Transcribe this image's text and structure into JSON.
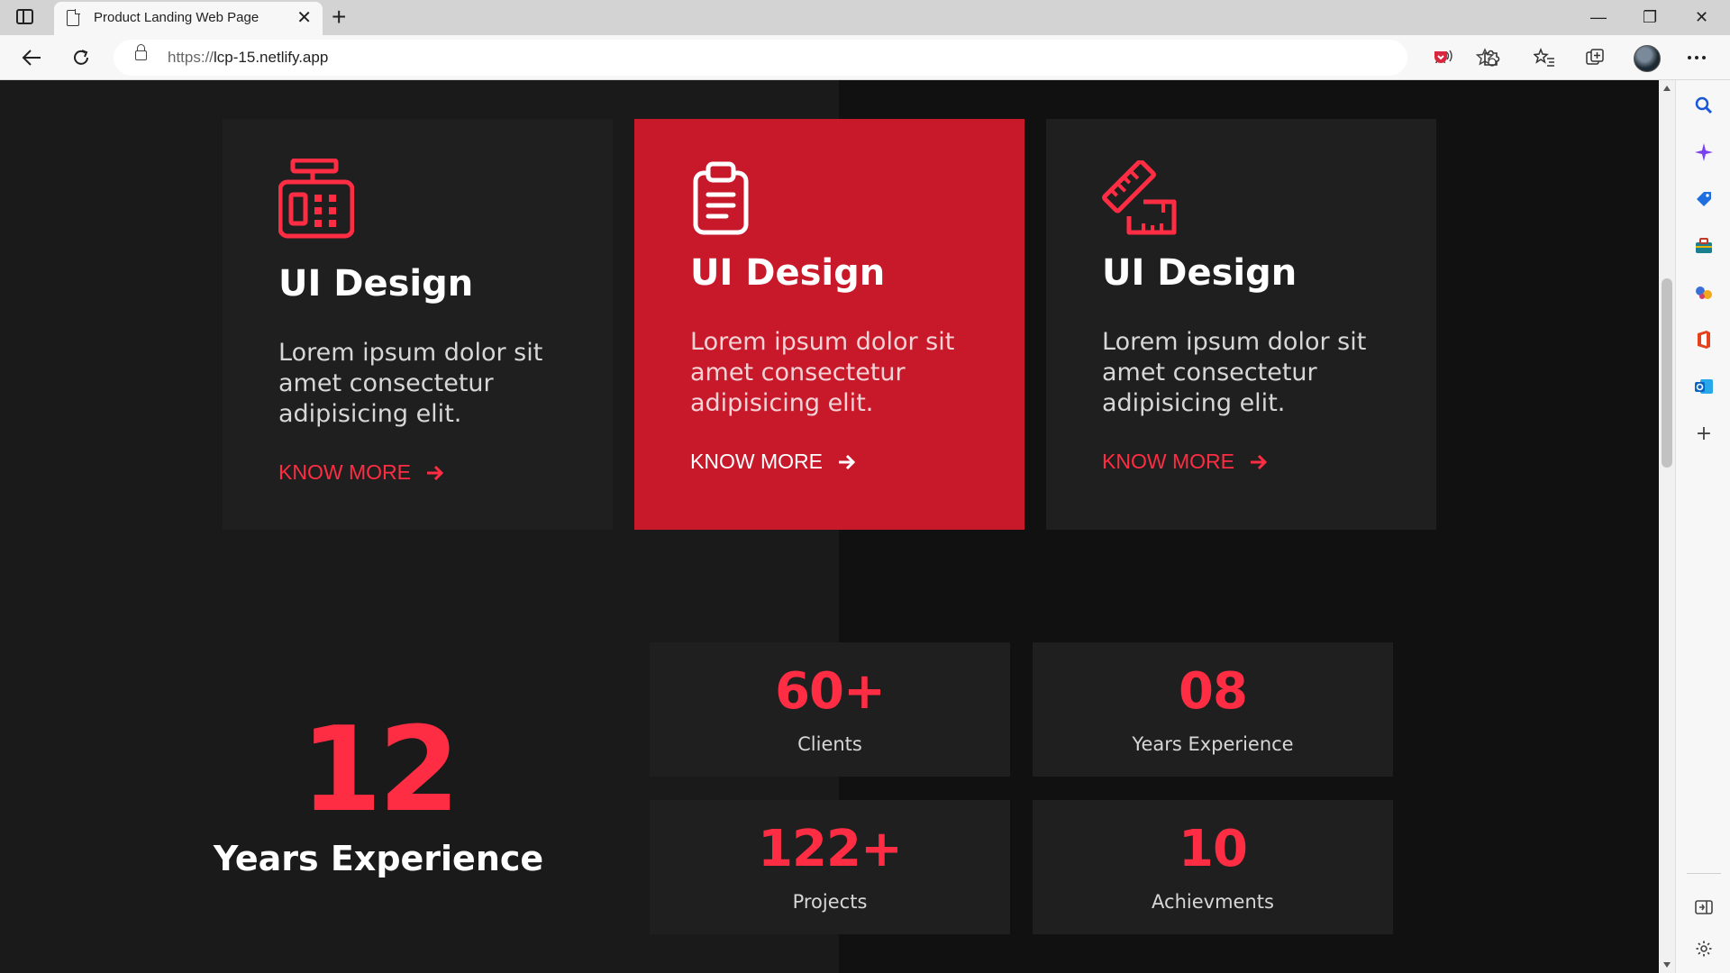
{
  "browser": {
    "tab_title": "Product Landing Web Page",
    "tab_close": "✕",
    "new_tab": "+",
    "url_scheme": "https://",
    "url_host": "lcp-15.netlify.app",
    "window_controls": {
      "minimize": "—",
      "maximize": "❐",
      "close": "✕"
    }
  },
  "services": [
    {
      "icon": "cash-register-icon",
      "title": "UI Design",
      "description": "Lorem ipsum dolor sit amet consectetur adipisicing elit.",
      "link": "KNOW MORE",
      "active": false
    },
    {
      "icon": "clipboard-icon",
      "title": "UI Design",
      "description": "Lorem ipsum dolor sit amet consectetur adipisicing elit.",
      "link": "KNOW MORE",
      "active": true
    },
    {
      "icon": "ruler-pencil-icon",
      "title": "UI Design",
      "description": "Lorem ipsum dolor sit amet consectetur adipisicing elit.",
      "link": "KNOW MORE",
      "active": false
    }
  ],
  "experience": {
    "number": "12",
    "label": "Years Experience"
  },
  "stats": [
    {
      "number": "60+",
      "label": "Clients"
    },
    {
      "number": "08",
      "label": "Years Experience"
    },
    {
      "number": "122+",
      "label": "Projects"
    },
    {
      "number": "10",
      "label": "Achievments"
    }
  ],
  "colors": {
    "accent": "#ff2d43",
    "active_card": "#c8192b",
    "card_bg": "#1f1f1f",
    "page_bg": "#1a1a1a"
  }
}
